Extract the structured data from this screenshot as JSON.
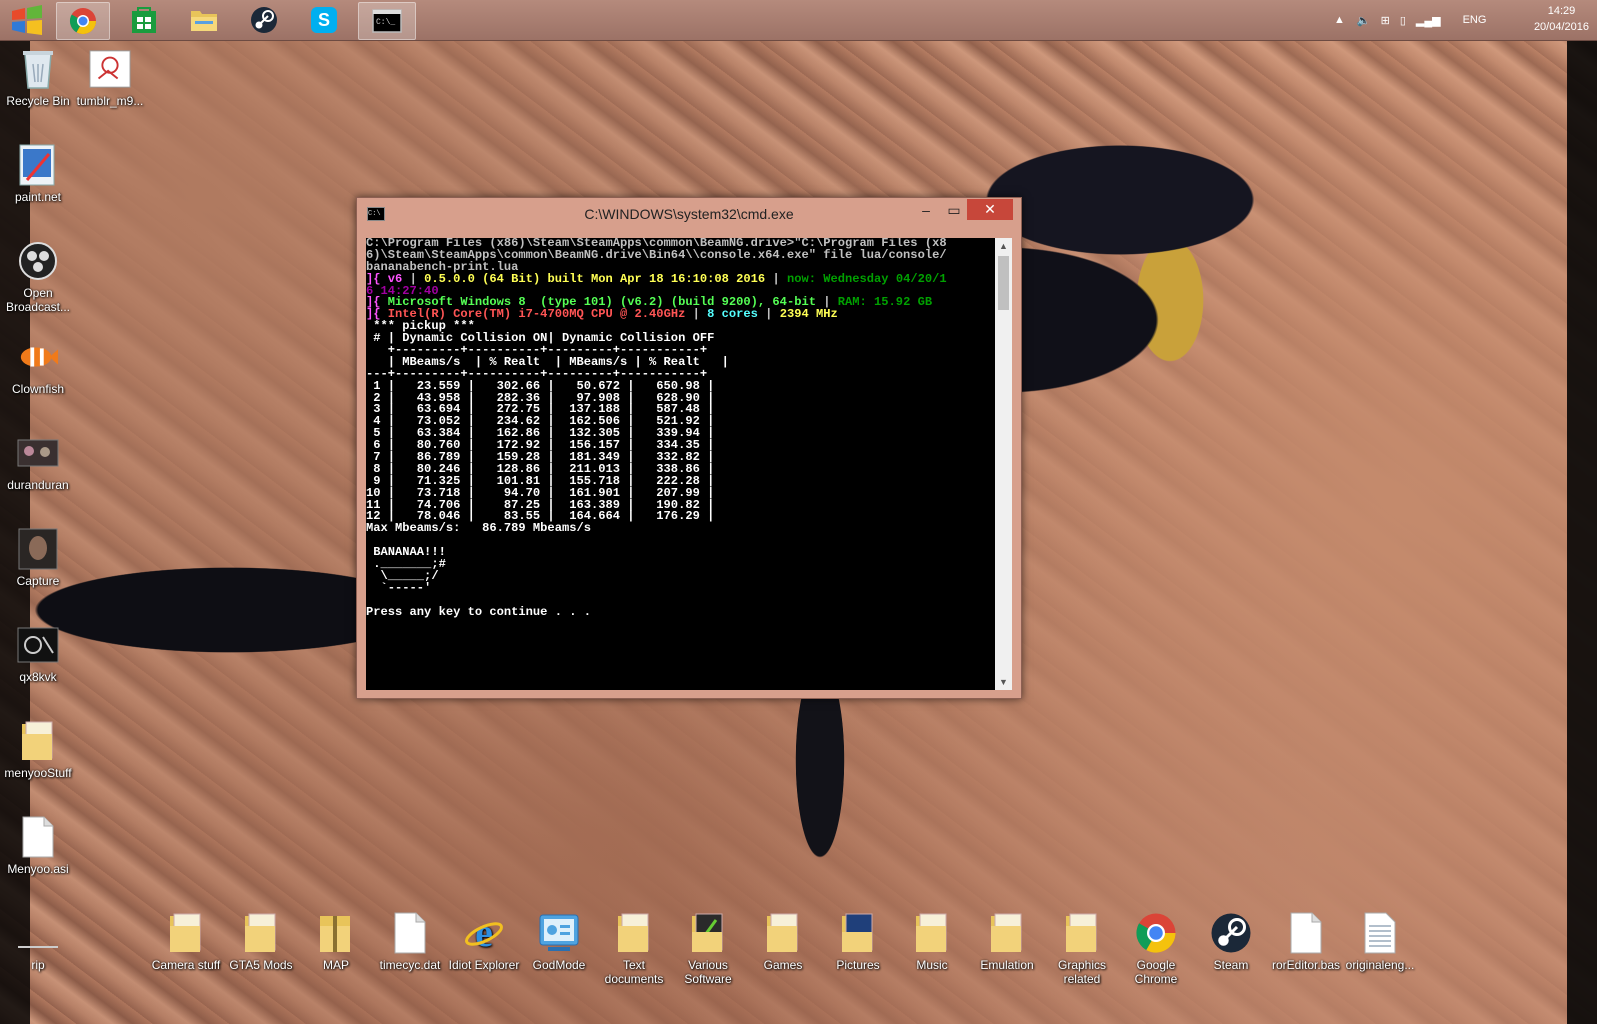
{
  "taskbar": {
    "apps": [
      {
        "name": "start-button",
        "icon": "windows-logo-icon"
      },
      {
        "name": "chrome",
        "icon": "chrome-icon"
      },
      {
        "name": "store",
        "icon": "store-icon"
      },
      {
        "name": "file-explorer",
        "icon": "folder-icon"
      },
      {
        "name": "steam",
        "icon": "steam-icon"
      },
      {
        "name": "skype",
        "icon": "skype-icon"
      },
      {
        "name": "cmd",
        "icon": "cmd-icon"
      }
    ],
    "tray": {
      "language": "ENG"
    },
    "clock": {
      "time": "14:29",
      "date": "20/04/2016"
    }
  },
  "desktop": {
    "left_icons": [
      {
        "label": "Recycle Bin",
        "icon": "recycle-bin-icon"
      },
      {
        "label": "tumblr_m9...",
        "icon": "image-file-icon"
      },
      {
        "label": "paint.net",
        "icon": "paint-net-icon"
      },
      {
        "label": "Open Broadcast...",
        "icon": "obs-icon"
      },
      {
        "label": "Clownfish",
        "icon": "clownfish-icon"
      },
      {
        "label": "duranduran",
        "icon": "image-file-icon"
      },
      {
        "label": "Capture",
        "icon": "image-file-icon"
      },
      {
        "label": "qx8kvk",
        "icon": "image-file-icon"
      },
      {
        "label": "menyooStuff",
        "icon": "folder-icon"
      },
      {
        "label": "Menyoo.asi",
        "icon": "file-icon"
      },
      {
        "label": "rip",
        "icon": "file-icon"
      }
    ],
    "bottom_icons": [
      {
        "label": "Camera stuff",
        "icon": "folder-icon"
      },
      {
        "label": "GTA5 Mods",
        "icon": "folder-icon"
      },
      {
        "label": "MAP",
        "icon": "zip-folder-icon"
      },
      {
        "label": "timecyc.dat",
        "icon": "file-icon"
      },
      {
        "label": "Idiot Explorer",
        "icon": "internet-explorer-icon"
      },
      {
        "label": "GodMode",
        "icon": "control-panel-icon"
      },
      {
        "label": "Text documents",
        "icon": "folder-icon"
      },
      {
        "label": "Various Software",
        "icon": "folder-icon"
      },
      {
        "label": "Games",
        "icon": "folder-icon"
      },
      {
        "label": "Pictures",
        "icon": "folder-icon"
      },
      {
        "label": "Music",
        "icon": "folder-icon"
      },
      {
        "label": "Emulation",
        "icon": "folder-icon"
      },
      {
        "label": "Graphics related",
        "icon": "folder-icon"
      },
      {
        "label": "Google Chrome",
        "icon": "chrome-icon"
      },
      {
        "label": "Steam",
        "icon": "steam-icon"
      },
      {
        "label": "rorEditor.bas",
        "icon": "file-icon"
      },
      {
        "label": "originaleng...",
        "icon": "text-file-icon"
      }
    ]
  },
  "cmd_window": {
    "title": "C:\\WINDOWS\\system32\\cmd.exe",
    "minimize": "–",
    "maximize": "▭",
    "close": "✕",
    "lines": [
      [
        {
          "t": "C:\\Program Files (x86)\\Steam\\SteamApps\\common\\BeamNG.drive>\"C:\\Program Files (x8",
          "c": "c-gray"
        }
      ],
      [
        {
          "t": "6)\\Steam\\SteamApps\\common\\BeamNG.drive\\Bin64\\\\console.x64.exe\" file lua/console/",
          "c": "c-gray"
        }
      ],
      [
        {
          "t": "bananabench-print.lua",
          "c": "c-gray"
        }
      ],
      [
        {
          "t": "]{ ",
          "c": "c-mag"
        },
        {
          "t": "v6 ",
          "c": "c-mag"
        },
        {
          "t": "| ",
          "c": "c-gray"
        },
        {
          "t": "0.5.0.0 (64 Bit) built Mon Apr 18 16:10:08 2016 ",
          "c": "c-yel"
        },
        {
          "t": "| ",
          "c": "c-gray"
        },
        {
          "t": "now: Wednesday 04/20/1",
          "c": "c-dgrn"
        }
      ],
      [
        {
          "t": "6 14:27:40",
          "c": "c-dmag"
        }
      ],
      [
        {
          "t": "]{ ",
          "c": "c-mag"
        },
        {
          "t": "Microsoft Windows 8  (type 101) (v6.2) (build 9200), 64-bit ",
          "c": "c-grn"
        },
        {
          "t": "| ",
          "c": "c-gray"
        },
        {
          "t": "RAM: 15.92 GB",
          "c": "c-dgrn"
        }
      ],
      [
        {
          "t": "]{ ",
          "c": "c-mag"
        },
        {
          "t": "Intel(R) Core(TM) i7-4700MQ CPU @ 2.40GHz ",
          "c": "c-red"
        },
        {
          "t": "| ",
          "c": "c-gray"
        },
        {
          "t": "8 cores ",
          "c": "c-cyan"
        },
        {
          "t": "| ",
          "c": "c-gray"
        },
        {
          "t": "2394 MHz",
          "c": "c-yel"
        }
      ],
      [
        {
          "t": " *** pickup ***",
          "c": "c-wht"
        }
      ],
      [
        {
          "t": " # | Dynamic Collision ON| Dynamic Collision OFF",
          "c": "c-wht"
        }
      ],
      [
        {
          "t": "   +---------+----------+---------+-----------+",
          "c": "c-wht"
        }
      ],
      [
        {
          "t": "   | MBeams/s  | % Realt  | MBeams/s | % Realt   |",
          "c": "c-wht"
        }
      ],
      [
        {
          "t": "---+---------+----------+---------+-----------+",
          "c": "c-wht"
        }
      ],
      [
        {
          "t": " 1 |   23.559 |   302.66 |   50.672 |   650.98 |",
          "c": "c-wht"
        }
      ],
      [
        {
          "t": " 2 |   43.958 |   282.36 |   97.908 |   628.90 |",
          "c": "c-wht"
        }
      ],
      [
        {
          "t": " 3 |   63.694 |   272.75 |  137.188 |   587.48 |",
          "c": "c-wht"
        }
      ],
      [
        {
          "t": " 4 |   73.052 |   234.62 |  162.506 |   521.92 |",
          "c": "c-wht"
        }
      ],
      [
        {
          "t": " 5 |   63.384 |   162.86 |  132.305 |   339.94 |",
          "c": "c-wht"
        }
      ],
      [
        {
          "t": " 6 |   80.760 |   172.92 |  156.157 |   334.35 |",
          "c": "c-wht"
        }
      ],
      [
        {
          "t": " 7 |   86.789 |   159.28 |  181.349 |   332.82 |",
          "c": "c-wht"
        }
      ],
      [
        {
          "t": " 8 |   80.246 |   128.86 |  211.013 |   338.86 |",
          "c": "c-wht"
        }
      ],
      [
        {
          "t": " 9 |   71.325 |   101.81 |  155.718 |   222.28 |",
          "c": "c-wht"
        }
      ],
      [
        {
          "t": "10 |   73.718 |    94.70 |  161.901 |   207.99 |",
          "c": "c-wht"
        }
      ],
      [
        {
          "t": "11 |   74.706 |    87.25 |  163.389 |   190.82 |",
          "c": "c-wht"
        }
      ],
      [
        {
          "t": "12 |   78.046 |    83.55 |  164.664 |   176.29 |",
          "c": "c-wht"
        }
      ],
      [
        {
          "t": "Max Mbeams/s:   86.789 Mbeams/s",
          "c": "c-wht"
        }
      ],
      [
        {
          "t": "",
          "c": "c-wht"
        }
      ],
      [
        {
          "t": " BANANAA!!!",
          "c": "c-wht"
        }
      ],
      [
        {
          "t": " ._______;#",
          "c": "c-wht"
        }
      ],
      [
        {
          "t": "  \\_____;/",
          "c": "c-wht"
        }
      ],
      [
        {
          "t": "  `-----'",
          "c": "c-wht"
        }
      ],
      [
        {
          "t": "",
          "c": "c-wht"
        }
      ],
      [
        {
          "t": "Press any key to continue . . .",
          "c": "c-wht"
        }
      ]
    ]
  }
}
